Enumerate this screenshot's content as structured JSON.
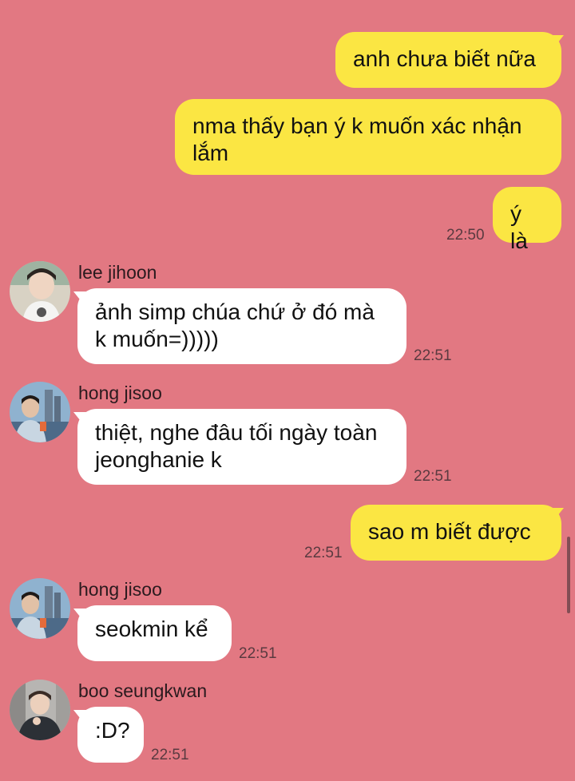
{
  "messages": [
    {
      "sender": "me",
      "text": "anh chưa biết nữa",
      "time": ""
    },
    {
      "sender": "me",
      "text": "nma thấy bạn ý k muốn xác nhận lắm",
      "time": ""
    },
    {
      "sender": "me",
      "text": "ý là",
      "time": "22:50"
    },
    {
      "sender": "lee jihoon",
      "text": "ảnh simp chúa chứ ở đó mà k muốn=)))))",
      "time": "22:51"
    },
    {
      "sender": "hong jisoo",
      "text": "thiệt, nghe đâu tối ngày toàn jeonghanie k",
      "time": "22:51"
    },
    {
      "sender": "me",
      "text": "sao m biết được",
      "time": "22:51"
    },
    {
      "sender": "hong jisoo",
      "text": "seokmin kể",
      "time": "22:51"
    },
    {
      "sender": "boo seungkwan",
      "text": ":D?",
      "time": "22:51"
    }
  ],
  "contacts": {
    "lee_jihoon": {
      "name": "lee jihoon",
      "avatar": "avatar-photo-icon"
    },
    "hong_jisoo": {
      "name": "hong jisoo",
      "avatar": "avatar-photo-icon"
    },
    "boo_seungkwan": {
      "name": "boo seungkwan",
      "avatar": "avatar-photo-icon"
    }
  },
  "colors": {
    "background": "#e27882",
    "outgoing_bubble": "#fbe643",
    "incoming_bubble": "#ffffff",
    "timestamp": "#5a3a40"
  }
}
